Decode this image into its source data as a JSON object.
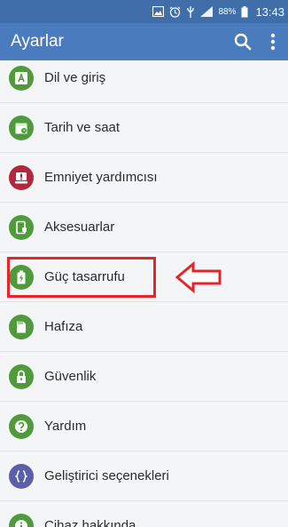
{
  "status_bar": {
    "battery": "88%",
    "time": "13:43"
  },
  "action_bar": {
    "title": "Ayarlar",
    "search_icon": "search-icon",
    "overflow_icon": "more-vert-icon"
  },
  "settings": {
    "items": [
      {
        "label": "Dil ve giriş",
        "icon": "language-icon",
        "color": "#4f9a3b"
      },
      {
        "label": "Tarih ve saat",
        "icon": "calendar-icon",
        "color": "#4f9a3b"
      },
      {
        "label": "Emniyet yardımcısı",
        "icon": "alert-icon",
        "color": "#b2273a"
      },
      {
        "label": "Aksesuarlar",
        "icon": "accessory-icon",
        "color": "#4f9a3b"
      },
      {
        "label": "Güç tasarrufu",
        "icon": "battery-icon",
        "color": "#4f9a3b"
      },
      {
        "label": "Hafıza",
        "icon": "storage-icon",
        "color": "#4f9a3b"
      },
      {
        "label": "Güvenlik",
        "icon": "lock-icon",
        "color": "#4f9a3b"
      },
      {
        "label": "Yardım",
        "icon": "help-icon",
        "color": "#4f9a3b"
      },
      {
        "label": "Geliştirici seçenekleri",
        "icon": "developer-icon",
        "color": "#5b5fa8"
      },
      {
        "label": "Cihaz hakkında",
        "icon": "info-icon",
        "color": "#4f9a3b"
      }
    ]
  },
  "annotation": {
    "highlight_color": "#e8242b"
  }
}
